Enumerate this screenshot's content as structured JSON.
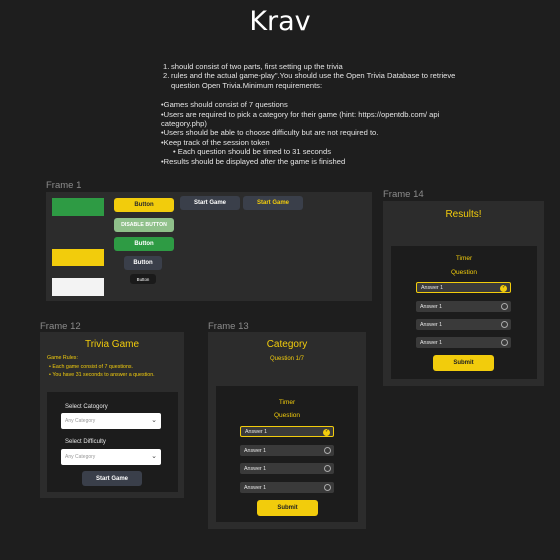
{
  "page": {
    "title": "Krav"
  },
  "requirements": {
    "ordered": [
      "should consist of two parts, first setting up the trivia",
      "rules and the actual game-play\".You should use the Open Trivia Database to retrieve question Open Trivia.Minimum requirements:"
    ],
    "bullets": [
      "•Games should consist of 7 questions",
      "•Users are required to pick a category for their game (hint: https://opentdb.com/ api category.php)",
      "•Users should be able to choose difficulty but are not required to.",
      "•Keep track of the session token"
    ],
    "sub_bullet": "Each question should be timed to 31 seconds",
    "last_bullet": "•Results should be displayed after the game is finished"
  },
  "frame1": {
    "label": "Frame 1",
    "buttons": {
      "yellow": "Button",
      "disabled": "DISABLE BUTTON",
      "green": "Button",
      "dark_medium": "Button",
      "dark_small": "Button",
      "start_game_dark": "Start Game",
      "start_game_yellow": "Start Game"
    }
  },
  "frame12": {
    "label": "Frame 12",
    "heading": "Trivia Game",
    "rules_title": "Game Rules:",
    "rules": [
      "Each game consist of 7 questions.",
      "You have 31 seconds to answer a question."
    ],
    "select_category_label": "Select Catogory",
    "category_placeholder": "Any Category",
    "select_difficulty_label": "Select Difficulty",
    "difficulty_placeholder": "Any Category",
    "start_button": "Start Game"
  },
  "frame13": {
    "label": "Frame 13",
    "heading": "Category",
    "progress": "Question 1/7",
    "timer": "Timer",
    "question": "Question",
    "answers": [
      "Answer 1",
      "Answer 1",
      "Answer 1",
      "Answer 1"
    ],
    "selected_index": 0,
    "submit": "Submit"
  },
  "frame14": {
    "label": "Frame 14",
    "heading": "Results!",
    "timer": "Timer",
    "question": "Question",
    "answers": [
      "Answer 1",
      "Answer 1",
      "Answer 1",
      "Answer 1"
    ],
    "selected_index": 0,
    "submit": "Submit"
  },
  "colors": {
    "accent_yellow": "#f2cc0c",
    "green": "#2e9b44",
    "background": "#1e1e1e",
    "frame": "#2c2c2c"
  }
}
